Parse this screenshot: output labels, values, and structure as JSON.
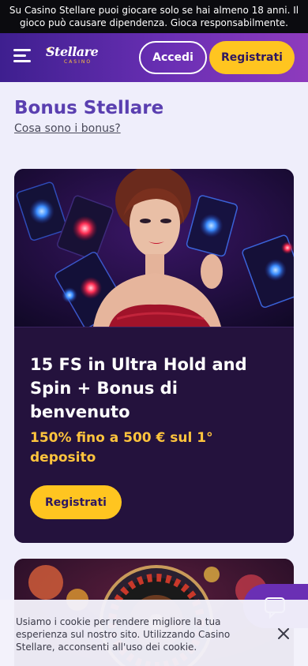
{
  "age_banner": {
    "text": "Su Casino Stellare puoi giocare solo se hai almeno 18 anni. Il gioco può causare dipendenza. Gioca responsabilmente."
  },
  "header": {
    "logo_main": "Stellare",
    "logo_sub": "CASINO",
    "login_label": "Accedi",
    "register_label": "Registrati",
    "menu_icon": "hamburger-menu-icon"
  },
  "main": {
    "title": "Bonus Stellare",
    "bonus_link": "Cosa sono i bonus?"
  },
  "bonus_card": {
    "title": "15 FS in Ultra Hold and Spin + Bonus di benvenuto",
    "subtitle": "150% fino a 500 € sul 1° deposito",
    "button_label": "Registrati"
  },
  "cookie_notice": {
    "text": "Usiamo i cookie per rendere migliore la tua esperienza sul nostro sito. Utilizzando Casino Stellare, acconsenti all'uso dei cookie.",
    "close_icon": "close-icon"
  },
  "colors": {
    "accent_purple": "#6a2fb4",
    "accent_yellow": "#ffc520",
    "card_bg": "#24123d",
    "title_purple": "#5a3fb0",
    "subtitle_gold": "#ffc43d"
  }
}
